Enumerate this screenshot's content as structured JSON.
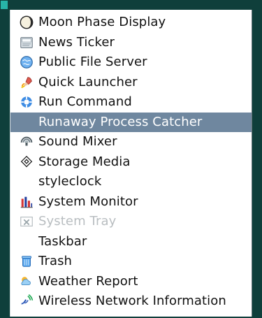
{
  "menu": {
    "items": [
      {
        "label": "Moon Phase Display",
        "icon": "moon-phase-icon",
        "selected": false,
        "disabled": false
      },
      {
        "label": "News Ticker",
        "icon": "news-ticker-icon",
        "selected": false,
        "disabled": false
      },
      {
        "label": "Public File Server",
        "icon": "globe-icon",
        "selected": false,
        "disabled": false
      },
      {
        "label": "Quick Launcher",
        "icon": "rocket-icon",
        "selected": false,
        "disabled": false
      },
      {
        "label": "Run Command",
        "icon": "run-command-icon",
        "selected": false,
        "disabled": false
      },
      {
        "label": "Runaway Process Catcher",
        "icon": "",
        "selected": true,
        "disabled": false
      },
      {
        "label": "Sound Mixer",
        "icon": "sound-mixer-icon",
        "selected": false,
        "disabled": false
      },
      {
        "label": "Storage Media",
        "icon": "storage-media-icon",
        "selected": false,
        "disabled": false
      },
      {
        "label": "styleclock",
        "icon": "",
        "selected": false,
        "disabled": false
      },
      {
        "label": "System Monitor",
        "icon": "system-monitor-icon",
        "selected": false,
        "disabled": false
      },
      {
        "label": "System Tray",
        "icon": "system-tray-icon",
        "selected": false,
        "disabled": true
      },
      {
        "label": "Taskbar",
        "icon": "",
        "selected": false,
        "disabled": false
      },
      {
        "label": "Trash",
        "icon": "trash-icon",
        "selected": false,
        "disabled": false
      },
      {
        "label": "Weather Report",
        "icon": "weather-report-icon",
        "selected": false,
        "disabled": false
      },
      {
        "label": "Wireless Network Information",
        "icon": "wireless-network-icon",
        "selected": false,
        "disabled": false
      }
    ]
  },
  "colors": {
    "selection": "#6f879f",
    "outer_background": "#0f3f3b",
    "accent_teal": "#27b4a8",
    "text": "#111111",
    "disabled_text": "#b9bec1"
  }
}
